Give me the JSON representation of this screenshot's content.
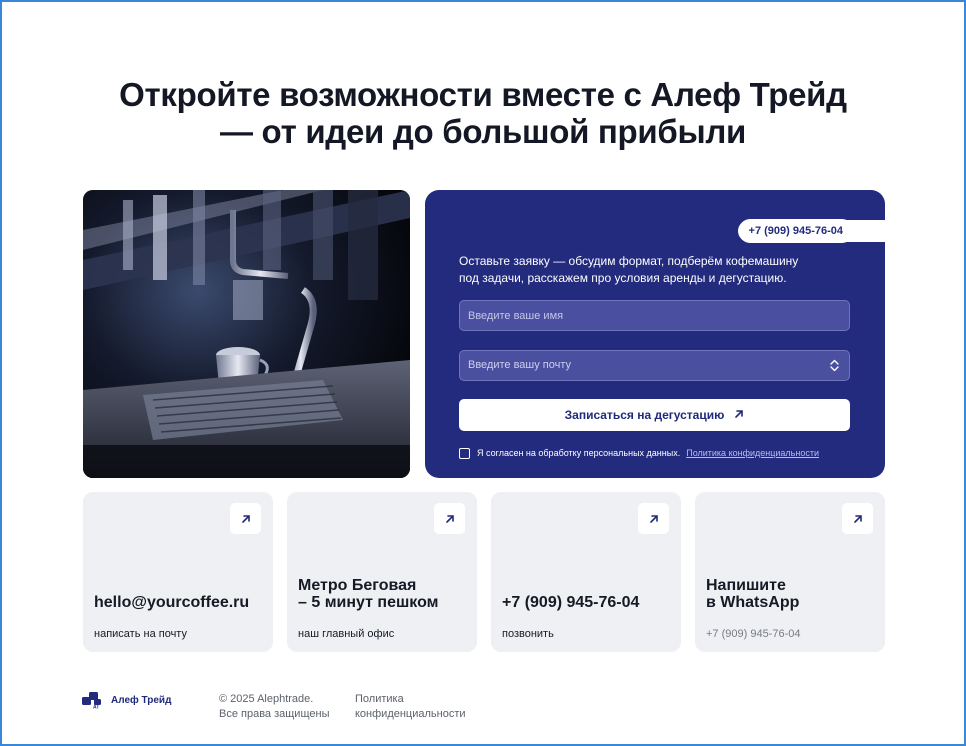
{
  "hero": {
    "title_line1": "Откройте возможности вместе с Алеф Трейд",
    "title_line2": "— от идеи до большой прибыли"
  },
  "form": {
    "phone": "+7 (909) 945-76-04",
    "intro_line1": "Оставьте заявку — обсудим формат, подберём кофемашину",
    "intro_line2": "под задачи, расскажем про условия аренды и дегустацию.",
    "name_placeholder": "Введите ваше имя",
    "email_placeholder": "Введите вашу почту",
    "submit_label": "Записаться на дегустацию",
    "consent_text": "Я согласен на обработку персональных данных.",
    "consent_link": "Политика конфиденциальности"
  },
  "contacts": [
    {
      "title_line1": "hello@yourcoffee.ru",
      "title_line2": "",
      "subtitle": "написать на почту"
    },
    {
      "title_line1": "Метро Беговая",
      "title_line2": "– 5 минут пешком",
      "subtitle": "наш главный офис"
    },
    {
      "title_line1": "+7 (909) 945-76-04",
      "title_line2": "",
      "subtitle": "позвонить"
    },
    {
      "title_line1": "Напишите",
      "title_line2": "в WhatsApp",
      "subtitle": "+7 (909) 945-76-04"
    }
  ],
  "footer": {
    "brand": "Алеф Трейд",
    "copyright_line1": "© 2025 Alephtrade.",
    "copyright_line2": "Все права защищены",
    "policy_line1": "Политика",
    "policy_line2": "конфиденциальности"
  },
  "colors": {
    "accent": "#232b7e",
    "card_bg": "#eff0f4",
    "border": "#3a86d8"
  },
  "icons": {
    "arrow": "arrow-up-right-icon",
    "select": "select-updown-icon",
    "logo": "alef-trade-logo"
  }
}
